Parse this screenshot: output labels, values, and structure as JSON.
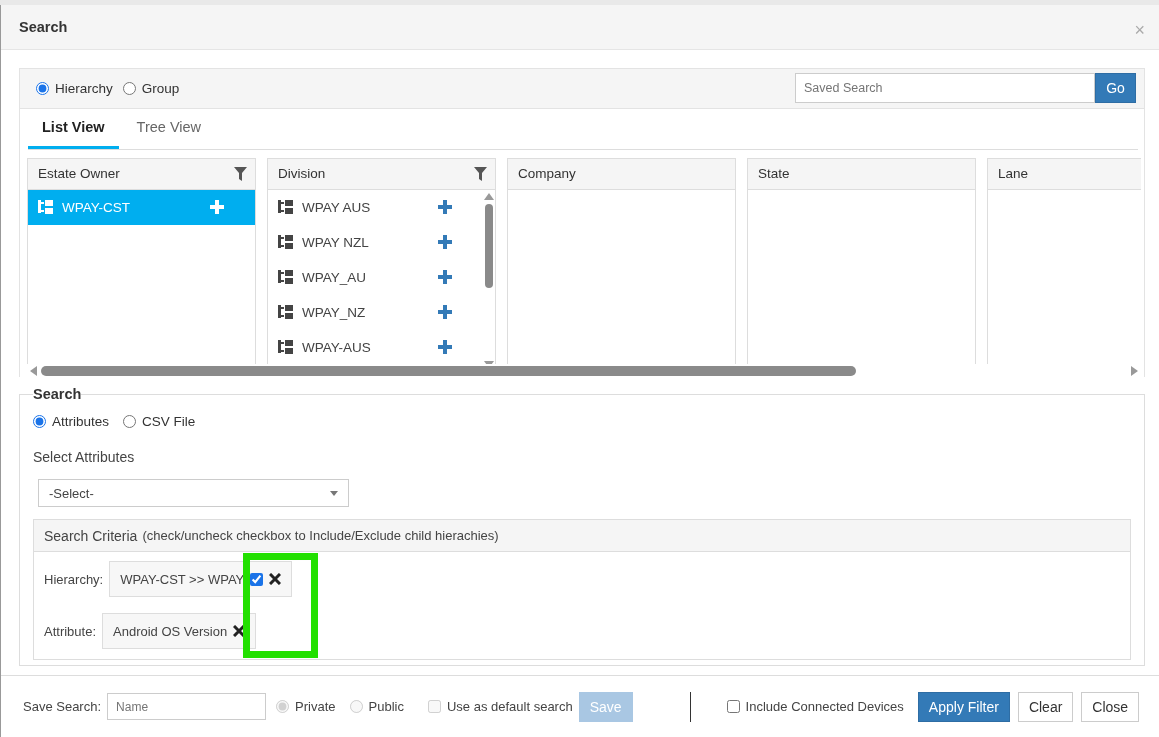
{
  "window": {
    "title": "Search",
    "close": "×"
  },
  "scope_options": [
    {
      "label": "Hierarchy",
      "selected": true
    },
    {
      "label": "Group",
      "selected": false
    }
  ],
  "saved_search": {
    "placeholder": "Saved Search",
    "button": "Go"
  },
  "tabs": [
    {
      "label": "List View",
      "selected": true
    },
    {
      "label": "Tree View",
      "selected": false
    }
  ],
  "columns": [
    {
      "title": "Estate Owner",
      "filter": true,
      "items": [
        {
          "label": "WPAY-CST",
          "selected": true
        }
      ]
    },
    {
      "title": "Division",
      "filter": true,
      "items": [
        {
          "label": "WPAY AUS",
          "selected": false
        },
        {
          "label": "WPAY NZL",
          "selected": false
        },
        {
          "label": "WPAY_AU",
          "selected": false
        },
        {
          "label": "WPAY_NZ",
          "selected": false
        },
        {
          "label": "WPAY-AUS",
          "selected": false
        }
      ]
    },
    {
      "title": "Company",
      "filter": false
    },
    {
      "title": "State",
      "filter": false
    },
    {
      "title": "Lane"
    }
  ],
  "search_section": {
    "legend": "Search",
    "source_options": [
      {
        "label": "Attributes",
        "selected": true
      },
      {
        "label": "CSV File",
        "selected": false
      }
    ],
    "select_label": "Select Attributes",
    "select_value": "-Select-",
    "criteria": {
      "title": "Search Criteria",
      "hint": "(check/uncheck checkbox to Include/Exclude child hierachies)",
      "rows": [
        {
          "label": "Hierarchy:",
          "value": "WPAY-CST >> WPAY",
          "kind": "checkbox",
          "checked": true
        },
        {
          "label": "Attribute:",
          "value": "Android OS Version",
          "kind": "plain"
        }
      ]
    }
  },
  "footer": {
    "save_label": "Save Search:",
    "name_placeholder": "Name",
    "visibility": [
      {
        "label": "Private",
        "selected": true,
        "disabled": true
      },
      {
        "label": "Public",
        "selected": false,
        "disabled": true
      }
    ],
    "default_search": {
      "label": "Use as default search",
      "checked": false,
      "disabled": true
    },
    "save_button": {
      "label": "Save",
      "disabled": true
    },
    "include_connected": {
      "label": "Include Connected Devices",
      "checked": false
    },
    "buttons": [
      {
        "label": "Apply Filter",
        "kind": "primary"
      },
      {
        "label": "Clear",
        "kind": "default"
      },
      {
        "label": "Close",
        "kind": "default"
      }
    ]
  }
}
